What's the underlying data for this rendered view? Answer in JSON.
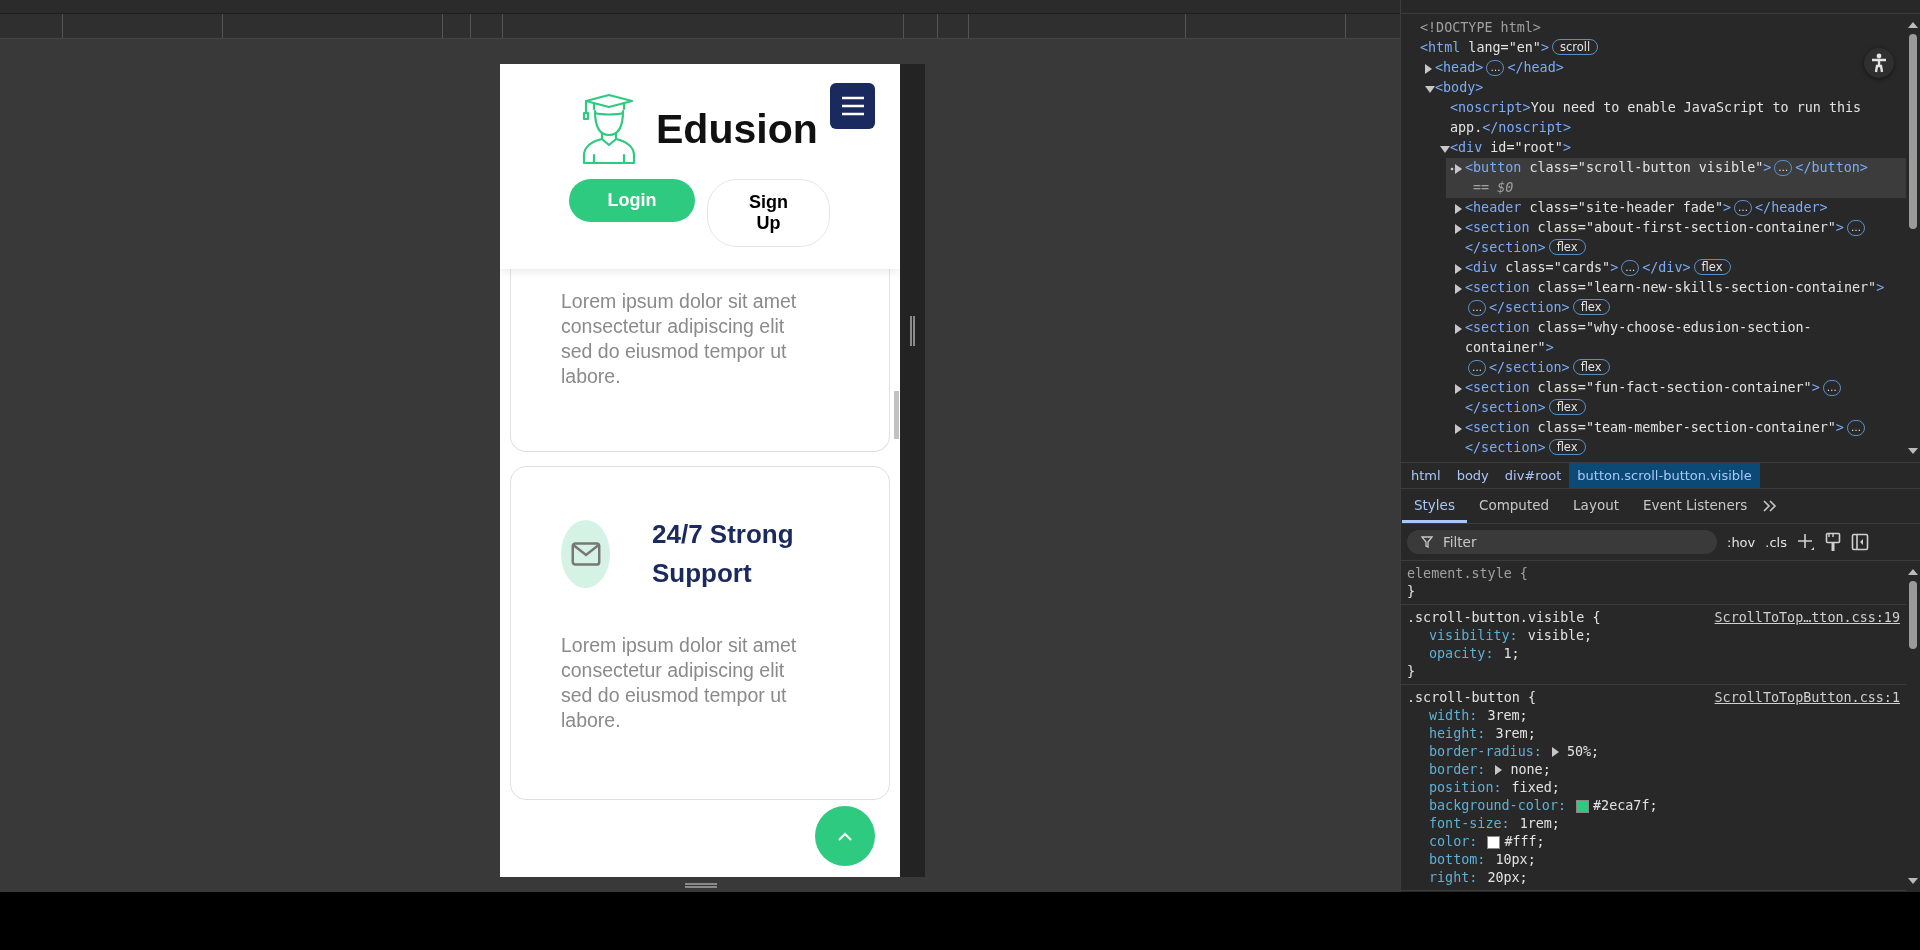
{
  "preview": {
    "header": {
      "brand": "Edusion",
      "menu_button": true,
      "buttons": [
        {
          "label": "Login",
          "kind": "primary"
        },
        {
          "label": "Sign Up",
          "kind": "outline"
        }
      ]
    },
    "cards": [
      {
        "kind": "text",
        "body": "Lorem ipsum dolor sit amet consectetur adipiscing elit sed do eiusmod tempor ut labore."
      },
      {
        "kind": "feature",
        "title": "24/7 Strong Support",
        "body": "Lorem ipsum dolor sit amet consectetur adipiscing elit sed do eiusmod tempor ut labore."
      }
    ],
    "scroll_button": true
  },
  "devtools": {
    "tree": [
      {
        "code": "<!DOCTYPE html>",
        "kind": "doctype",
        "selected": false
      },
      {
        "code": "<html lang=\"en\">",
        "badge": "scroll",
        "selected": false,
        "children": [
          {
            "code": "<head>",
            "more": "…",
            "close": "</head>",
            "expanded": false,
            "selected": false
          },
          {
            "code": "<body>",
            "expanded": true,
            "selected": false,
            "children": [
              {
                "code": "<noscript>You need to enable JavaScript to run this app.</noscript>",
                "selected": false
              },
              {
                "code": "<div id=\"root\">",
                "expanded": true,
                "selected": false,
                "children": [
                  {
                    "code": "<button class=\"scroll-button visible\">",
                    "more": "…",
                    "close": "</button>",
                    "ref": "== $0",
                    "expanded": false,
                    "selected": true
                  },
                  {
                    "code": "<header class=\"site-header fade\">",
                    "more": "…",
                    "close": "</header>",
                    "expanded": false,
                    "selected": false
                  },
                  {
                    "code": "<section class=\"about-first-section-container\">",
                    "more": "…",
                    "close": "</section>",
                    "badge": "flex",
                    "expanded": false,
                    "selected": false
                  },
                  {
                    "code": "<div class=\"cards\">",
                    "more": "…",
                    "close": "</div>",
                    "badge": "flex",
                    "expanded": false,
                    "selected": false
                  },
                  {
                    "code": "<section class=\"learn-new-skills-section-container\">",
                    "more": "…",
                    "close": "</section>",
                    "badge": "flex",
                    "expanded": false,
                    "selected": false
                  },
                  {
                    "code": "<section class=\"why-choose-edusion-section-container\">",
                    "more": "…",
                    "close": "</section>",
                    "badge": "flex",
                    "expanded": false,
                    "selected": false
                  },
                  {
                    "code": "<section class=\"fun-fact-section-container\">",
                    "more": "…",
                    "close": "</section>",
                    "badge": "flex",
                    "expanded": false,
                    "selected": false
                  },
                  {
                    "code": "<section class=\"team-member-section-container\">",
                    "more": "…",
                    "close": "</section>",
                    "badge": "flex",
                    "expanded": false,
                    "selected": false
                  }
                ]
              }
            ]
          }
        ]
      }
    ],
    "breadcrumbs": [
      {
        "label": "html",
        "selected": false
      },
      {
        "label": "body",
        "selected": false
      },
      {
        "label": "div#root",
        "selected": false
      },
      {
        "label": "button.scroll-button.visible",
        "selected": true
      }
    ],
    "tabs": [
      {
        "label": "Styles",
        "selected": true
      },
      {
        "label": "Computed",
        "selected": false
      },
      {
        "label": "Layout",
        "selected": false
      },
      {
        "label": "Event Listeners",
        "selected": false
      }
    ],
    "filter": {
      "placeholder": "Filter"
    },
    "toggles": [
      ":hov",
      ".cls"
    ],
    "rules": [
      {
        "selector": "element.style {",
        "kind": "inline",
        "close": "}"
      },
      {
        "selector": ".scroll-button.visible {",
        "source": "ScrollToTop…tton.css:19",
        "close": "}",
        "props": [
          {
            "name": "visibility:",
            "value": "visible;"
          },
          {
            "name": "opacity:",
            "value": "1;"
          }
        ]
      },
      {
        "selector": ".scroll-button {",
        "source": "ScrollToTopButton.css:1",
        "props": [
          {
            "name": "width:",
            "value": "3rem;"
          },
          {
            "name": "height:",
            "value": "3rem;"
          },
          {
            "name": "border-radius:",
            "value": "50%;",
            "shorthand": true
          },
          {
            "name": "border:",
            "value": "none;",
            "shorthand": true
          },
          {
            "name": "position:",
            "value": "fixed;"
          },
          {
            "name": "background-color:",
            "value": "#2eca7f;",
            "color": "#2eca7f"
          },
          {
            "name": "font-size:",
            "value": "1rem;"
          },
          {
            "name": "color:",
            "value": "#fff;",
            "color": "#ffffff"
          },
          {
            "name": "bottom:",
            "value": "10px;"
          },
          {
            "name": "right:",
            "value": "20px;"
          }
        ]
      }
    ]
  }
}
